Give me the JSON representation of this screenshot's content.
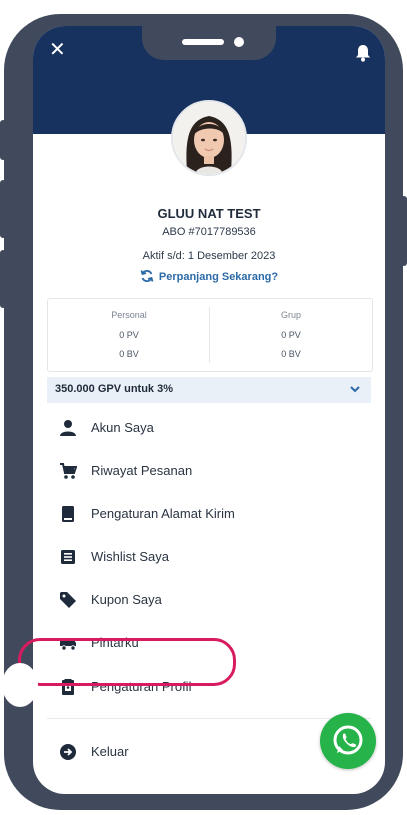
{
  "profile": {
    "name": "GLUU NAT TEST",
    "abo": "ABO #7017789536",
    "active": "Aktif s/d:  1 Desember 2023",
    "renew": "Perpanjang Sekarang?"
  },
  "stats": {
    "personal": {
      "label": "Personal",
      "pv": "0 PV",
      "bv": "0 BV"
    },
    "group": {
      "label": "Grup",
      "pv": "0 PV",
      "bv": "0 BV"
    }
  },
  "gpv_banner": "350.000 GPV untuk 3%",
  "menu": [
    {
      "label": "Akun Saya",
      "icon": "person-icon"
    },
    {
      "label": "Riwayat Pesanan",
      "icon": "cart-icon"
    },
    {
      "label": "Pengaturan Alamat Kirim",
      "icon": "address-book-icon"
    },
    {
      "label": "Wishlist Saya",
      "icon": "list-icon"
    },
    {
      "label": "Kupon Saya",
      "icon": "tag-icon"
    },
    {
      "label": "Pintarku",
      "icon": "truck-icon"
    },
    {
      "label": "Pengaturan Profil",
      "icon": "profile-card-icon"
    }
  ],
  "logout": "Keluar",
  "colors": {
    "header": "#17325e",
    "accent": "#2c6aa8",
    "highlight": "#d81b60",
    "whatsapp": "#25b34a",
    "frame": "#414a5c"
  }
}
